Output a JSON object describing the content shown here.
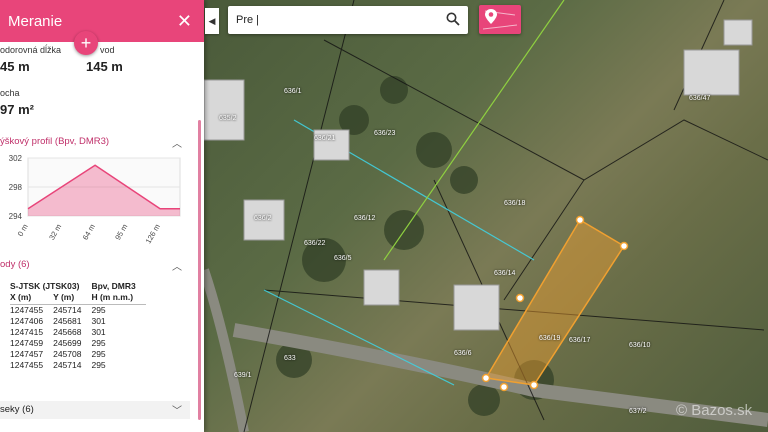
{
  "panel": {
    "title": "Meranie",
    "stats": [
      {
        "label": "odorovná dĺžka",
        "value": "45 m"
      },
      {
        "label": "vod",
        "value": "145 m"
      },
      {
        "label": "ocha",
        "value": "97 m²"
      }
    ],
    "profile_title": "ýškový profil (Bpv, DMR3)",
    "points_title": "ody (6)",
    "segments_title": "seky (6)",
    "table": {
      "header_left": "S-JTSK (JTSK03)",
      "header_right": "Bpv, DMR3",
      "columns": [
        "X (m)",
        "Y (m)",
        "H (m n.m.)"
      ],
      "rows": [
        [
          "1247455",
          "245714",
          "295"
        ],
        [
          "1247406",
          "245681",
          "301"
        ],
        [
          "1247415",
          "245668",
          "301"
        ],
        [
          "1247459",
          "245699",
          "295"
        ],
        [
          "1247457",
          "245708",
          "295"
        ],
        [
          "1247455",
          "245714",
          "295"
        ]
      ]
    }
  },
  "chart_data": {
    "type": "area",
    "x": [
      0,
      32,
      64,
      95,
      126,
      145
    ],
    "values": [
      295,
      298,
      301,
      298,
      295,
      295
    ],
    "x_tick_labels": [
      "0 m",
      "32 m",
      "64 m",
      "95 m",
      "126 m"
    ],
    "y_ticks": [
      294,
      298,
      302
    ],
    "ylim": [
      294,
      302
    ],
    "xlim": [
      0,
      145
    ],
    "ylabel": "",
    "color": "#e8457a"
  },
  "search": {
    "value": "Pre |"
  },
  "map": {
    "parcel_labels": [
      "636/18",
      "636/19",
      "636/17",
      "636/10",
      "636/14",
      "636/12",
      "636/22",
      "636/21",
      "636/23",
      "636/6",
      "636/5",
      "636/47",
      "636/2",
      "635/2",
      "636/1",
      "633",
      "639/1",
      "637/2"
    ],
    "watermark": "© Bazos.sk"
  },
  "colors": {
    "accent": "#e8457a",
    "polygon": "#f0a030"
  }
}
